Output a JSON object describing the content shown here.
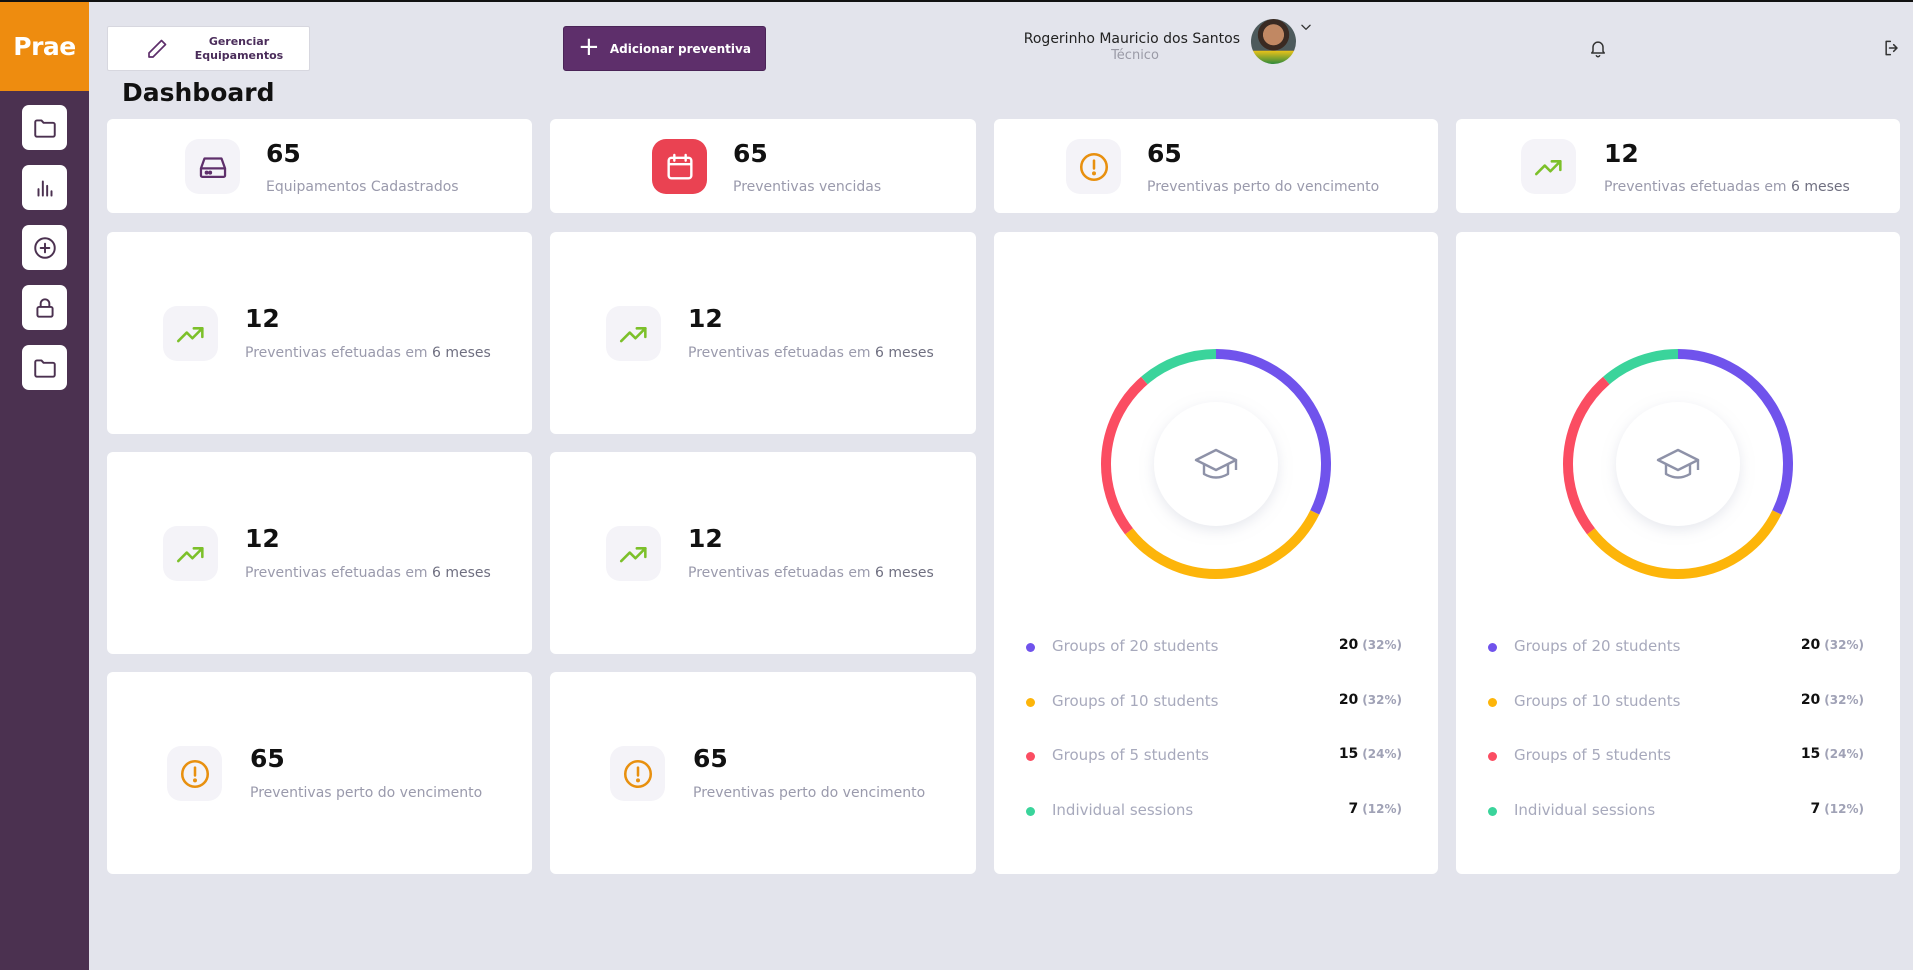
{
  "app": {
    "logo": "Prae"
  },
  "sidebar": {
    "items": [
      {
        "icon": "folder-icon"
      },
      {
        "icon": "bar-chart-icon"
      },
      {
        "icon": "plus-circle-icon"
      },
      {
        "icon": "lock-icon"
      },
      {
        "icon": "folder-icon"
      }
    ]
  },
  "header": {
    "manage_button": "Gerenciar\nEquipamentos",
    "add_button": "Adicionar preventiva",
    "user_name": "Rogerinho Mauricio dos Santos",
    "user_role": "Técnico"
  },
  "page": {
    "title": "Dashboard"
  },
  "stats_top": [
    {
      "value": "65",
      "label": "Equipamentos Cadastrados",
      "icon": "hard-drive-icon"
    },
    {
      "value": "65",
      "label": "Preventivas vencidas",
      "icon": "calendar-icon",
      "accent": "#ea4252"
    },
    {
      "value": "65",
      "label": "Preventivas perto do vencimento",
      "icon": "alert-circle-icon",
      "accent": "#e8900f"
    },
    {
      "value": "12",
      "label_prefix": "Preventivas efetuadas em ",
      "label_emph": "6 meses",
      "icon": "trending-up-icon",
      "accent": "#7cc02a"
    }
  ],
  "stats_grid": [
    {
      "value": "12",
      "label_prefix": "Preventivas efetuadas em ",
      "label_emph": "6 meses",
      "icon": "trending-up-icon"
    },
    {
      "value": "12",
      "label_prefix": "Preventivas efetuadas em ",
      "label_emph": "6 meses",
      "icon": "trending-up-icon"
    },
    {
      "value": "12",
      "label_prefix": "Preventivas efetuadas em ",
      "label_emph": "6 meses",
      "icon": "trending-up-icon"
    },
    {
      "value": "12",
      "label_prefix": "Preventivas efetuadas em ",
      "label_emph": "6 meses",
      "icon": "trending-up-icon"
    },
    {
      "value": "65",
      "label": "Preventivas perto do vencimento",
      "icon": "alert-circle-icon"
    },
    {
      "value": "65",
      "label": "Preventivas perto do vencimento",
      "icon": "alert-circle-icon"
    }
  ],
  "chart_data": [
    {
      "type": "pie",
      "center_icon": "graduation-cap-icon",
      "series": [
        {
          "name": "Groups of 20 students",
          "value": 20,
          "percent": "(32%)",
          "color": "#7053ec"
        },
        {
          "name": "Groups of 10 students",
          "value": 20,
          "percent": "(32%)",
          "color": "#fdb50a"
        },
        {
          "name": "Groups of 5 students",
          "value": 15,
          "percent": "(24%)",
          "color": "#fb4d62"
        },
        {
          "name": "Individual sessions",
          "value": 7,
          "percent": "(12%)",
          "color": "#3ad49b"
        }
      ]
    },
    {
      "type": "pie",
      "center_icon": "graduation-cap-icon",
      "series": [
        {
          "name": "Groups of 20 students",
          "value": 20,
          "percent": "(32%)",
          "color": "#7053ec"
        },
        {
          "name": "Groups of 10 students",
          "value": 20,
          "percent": "(32%)",
          "color": "#fdb50a"
        },
        {
          "name": "Groups of 5 students",
          "value": 15,
          "percent": "(24%)",
          "color": "#fb4d62"
        },
        {
          "name": "Individual sessions",
          "value": 7,
          "percent": "(12%)",
          "color": "#3ad49b"
        }
      ]
    }
  ]
}
